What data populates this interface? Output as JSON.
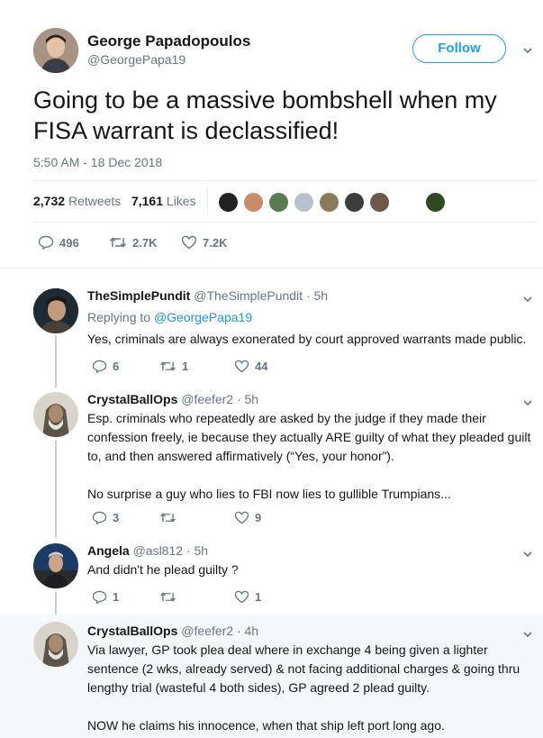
{
  "main_tweet": {
    "name": "George Papadopoulos",
    "handle": "@GeorgePapa19",
    "follow_label": "Follow",
    "text": "Going to be a massive bombshell when my FISA warrant is declassified!",
    "timestamp": "5:50 AM - 18 Dec 2018",
    "retweets_count": "2,732",
    "retweets_label": "Retweets",
    "likes_count": "7,161",
    "likes_label": "Likes",
    "actions": {
      "replies": "496",
      "retweets": "2.7K",
      "likes": "7.2K"
    }
  },
  "replies": [
    {
      "name": "TheSimplePundit",
      "handle": "@TheSimplePundit",
      "time": "· 5h",
      "replying_prefix": "Replying to",
      "replying_handle": "@GeorgePapa19",
      "text": "Yes, criminals are always exonerated by court approved warrants made public.",
      "replies": "6",
      "retweets": "1",
      "likes": "44"
    },
    {
      "name": "CrystalBallOps",
      "handle": "@feefer2",
      "time": "· 5h",
      "text_line1": "Esp. criminals who repeatedly are asked by the judge if they made their",
      "text_line2": "confession freely, ie because they actually ARE guilty of what they pleaded guilt",
      "text_line3": "to, and then answered affirmatively (“Yes, your honor”).",
      "text_line4": "No surprise a guy who lies to FBI now lies to gullible Trumpians...",
      "replies": "3",
      "retweets": "",
      "likes": "9"
    },
    {
      "name": "Angela",
      "handle": "@asl812",
      "time": "· 5h",
      "text": "And didn't he plead guilty ?",
      "replies": "1",
      "retweets": "",
      "likes": "1"
    },
    {
      "name": "CrystalBallOps",
      "handle": "@feefer2",
      "time": "· 4h",
      "text_line1": "Via lawyer, GP took plea deal where in exchange 4 being given a lighter",
      "text_line2": "sentence (2 wks, already served) & not facing additional charges & going thru",
      "text_line3": "lengthy trial (wasteful 4 both sides), GP agreed 2 plead guilty.",
      "text_line4": "NOW he claims his innocence, when that ship left port long ago."
    }
  ],
  "colors": {
    "accent": "#1da1f2",
    "link": "#1b95e0",
    "muted": "#657786",
    "divider": "#e6ecf0",
    "highlight_bg": "#f5f8fa"
  }
}
